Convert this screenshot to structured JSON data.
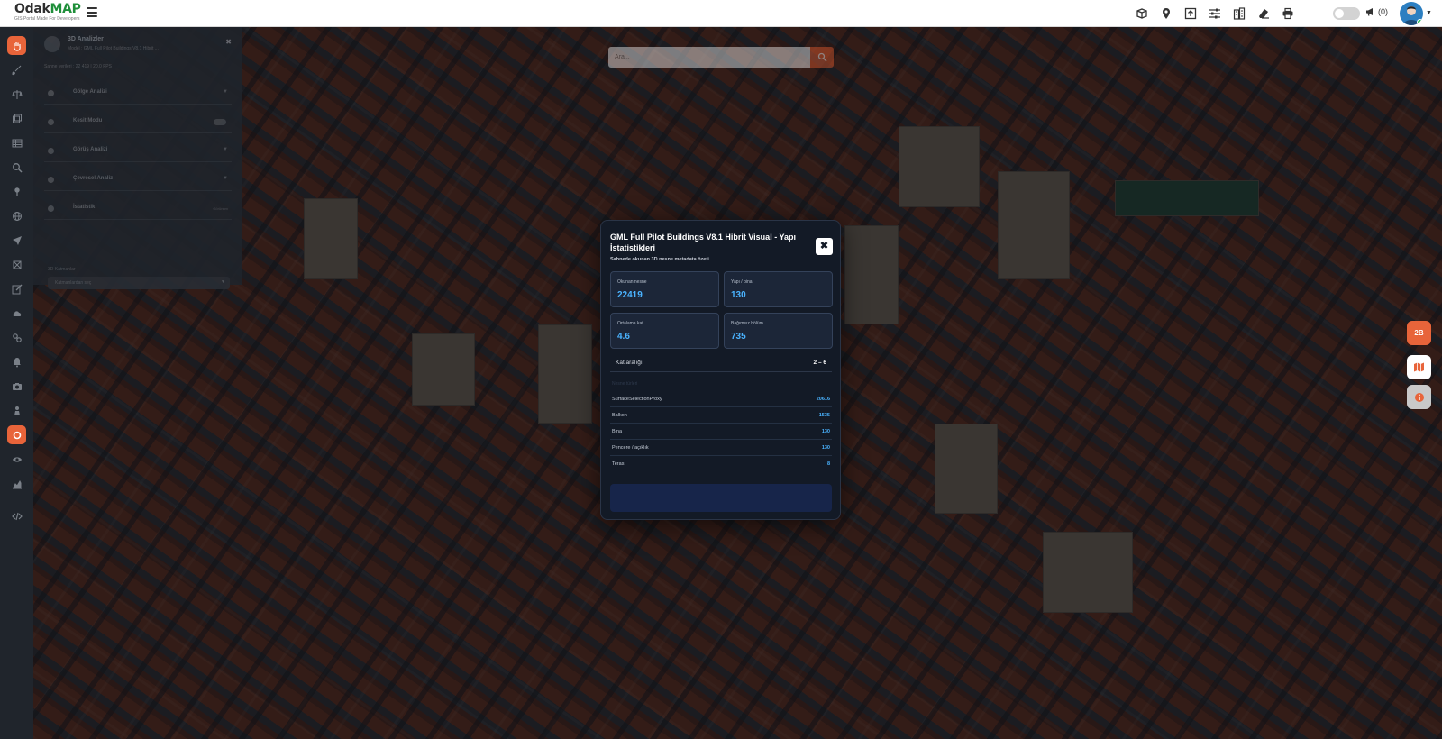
{
  "app": {
    "logo_main": "Odak",
    "logo_accent": "MAP",
    "logo_sub": "GIS Portal Made For Developers"
  },
  "header": {
    "toolbar_icons": [
      "3d-box-icon",
      "map-pin-icon",
      "upload-icon",
      "sliders-icon",
      "buildings-icon",
      "eraser-icon",
      "print-icon"
    ],
    "toggle_label": "",
    "notification_count": "(0)"
  },
  "sidebar_tools": [
    "hand-icon",
    "brush-icon",
    "scale-icon",
    "layers-icon",
    "table-icon",
    "search-icon",
    "pin-icon",
    "globe-icon",
    "navigation-icon",
    "frame-icon",
    "edit-icon",
    "cloud-icon",
    "link-icon",
    "alert-icon",
    "camera-icon",
    "person-icon",
    "analysis-3d-icon",
    "eye-icon",
    "chart-icon",
    "code-icon"
  ],
  "side_panel": {
    "title": "3D Analizler",
    "subtitle": "Model : GML Full Pilot Buildings V8.1 Hibrit ...",
    "meta": "Sahne verileri : 22 419 | 20.0 FPS",
    "rows": [
      {
        "label": "Gölge Analizi",
        "control": "chevron"
      },
      {
        "label": "Kesit Modu",
        "control": "switch"
      },
      {
        "label": "Görüş Analizi",
        "control": "chevron"
      },
      {
        "label": "Çevresel Analiz",
        "control": "chevron"
      },
      {
        "label": "İstatistik",
        "control": "note",
        "note": "Görünüm"
      }
    ],
    "section_label": "3D Katmanlar",
    "select_value": "Katmanlardan seç"
  },
  "search": {
    "placeholder": "Ara..."
  },
  "float_buttons": {
    "mode_label": "2B"
  },
  "modal": {
    "title": "GML Full Pilot Buildings V8.1 Hibrit Visual - Yapı İstatistikleri",
    "subtitle": "Sahnede okunan 3D nesne metadata özeti",
    "cards": [
      {
        "label": "Okunan nesne",
        "value": "22419"
      },
      {
        "label": "Yapı / bina",
        "value": "130"
      },
      {
        "label": "Ortalama kat",
        "value": "4.6"
      },
      {
        "label": "Bağımsız bölüm",
        "value": "735"
      }
    ],
    "range": {
      "label": "Kat aralığı",
      "value": "2 – 6"
    },
    "section_label": "Nesne türleri",
    "types": [
      {
        "name": "SurfaceSelectionProxy",
        "count": "20616"
      },
      {
        "name": "Balkon",
        "count": "1535"
      },
      {
        "name": "Bina",
        "count": "130"
      },
      {
        "name": "Pencere / açıklık",
        "count": "130"
      },
      {
        "name": "Teras",
        "count": "8"
      }
    ]
  },
  "colors": {
    "accent": "#e8643a",
    "value_blue": "#4ab3ff",
    "modal_bg": "#131a26"
  }
}
